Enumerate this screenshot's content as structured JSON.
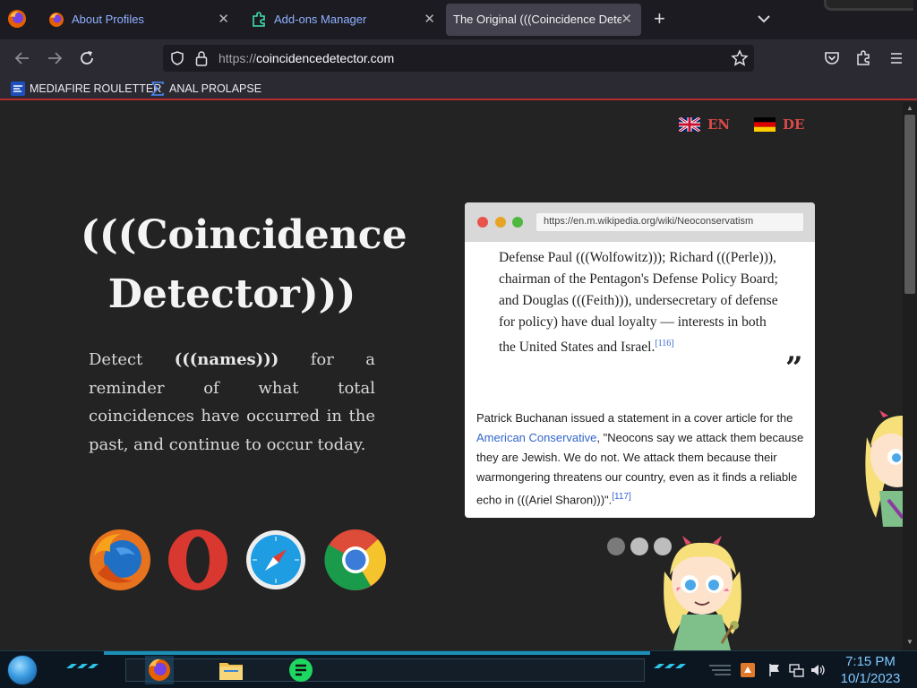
{
  "browser": {
    "tabs": [
      {
        "title": "About Profiles",
        "icon": "firefox-icon",
        "active": false
      },
      {
        "title": "Add-ons Manager",
        "icon": "puzzle-piece-icon",
        "active": false
      },
      {
        "title": "The Original (((Coincidence Detector)))",
        "icon": "none",
        "active": true
      }
    ],
    "close_glyph": "✕",
    "new_tab_glyph": "+",
    "url_scheme": "https://",
    "url_host": "coincidencedetector.com",
    "bookmarks": [
      {
        "label": "MEDIAFIRE ROULETTER",
        "icon": "mediafire-icon"
      },
      {
        "label": "ANAL PROLAPSE",
        "icon": "sigma-icon"
      }
    ]
  },
  "page": {
    "lang_en": "EN",
    "lang_de": "DE",
    "title_line1": "(((Coincidence",
    "title_line2": "Detector)))",
    "desc_pre": "Detect ",
    "desc_bold": "(((names)))",
    "desc_post": " for a reminder of what total coincidences have occurred in the past, and continue to occur today.",
    "browser_icons": [
      "firefox-browser-icon",
      "opera-browser-icon",
      "safari-browser-icon",
      "chrome-browser-icon"
    ],
    "card": {
      "address": "https://en.m.wikipedia.org/wiki/Neoconservatism",
      "quote": "Defense Paul (((Wolfowitz))); Richard (((Perle))), chairman of the Pentagon's Defense Policy Board; and Douglas (((Feith))), undersecretary of defense for policy) have dual loyalty — interests in both the United States and Israel.",
      "quote_ref": "[116]",
      "quote_mark": "”",
      "para_pre": "Patrick Buchanan issued a statement in a cover article for the ",
      "para_link": "American Conservative",
      "para_post": ", \"Neocons say we attack them because they are Jewish. We do not. We attack them because their warmongering threatens our country, even as it finds a reliable echo in (((Ariel Sharon)))\".",
      "para_ref": "[117]"
    },
    "pager_count": 3
  },
  "taskbar": {
    "time": "7:15 PM",
    "date": "10/1/2023",
    "apps": [
      "firefox-icon",
      "file-explorer-icon",
      "notes-app-icon"
    ],
    "tray": [
      "notification-icon",
      "flag-icon",
      "network-icon",
      "volume-icon"
    ]
  },
  "colors": {
    "accent_red": "#d94a4a",
    "link_blue": "#3366cc",
    "tab_link": "#8fb2ff",
    "taskbar_clock": "#7fc7ff"
  }
}
